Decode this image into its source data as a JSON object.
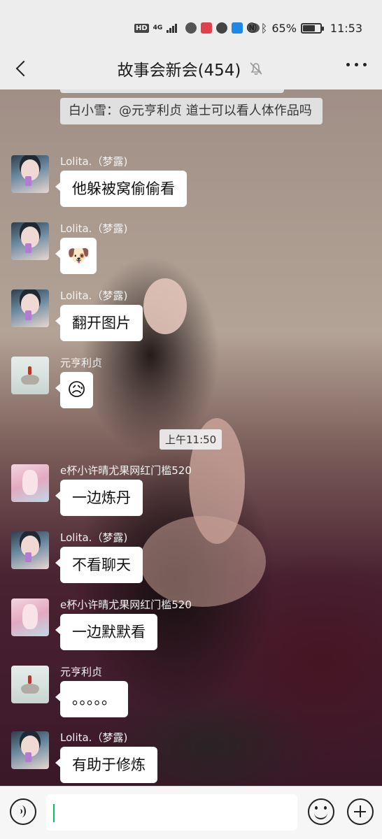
{
  "status_bar": {
    "hd": "HD",
    "network": "4G",
    "battery": "65%",
    "time": "11:53",
    "icons": [
      "hd-icon",
      "signal-icon",
      "app-icon",
      "app-icon",
      "app-icon",
      "app-icon",
      "wechat-icon",
      "nfc-icon",
      "bluetooth-icon",
      "battery-icon"
    ]
  },
  "header": {
    "title": "故事会新会(454)",
    "muted": true
  },
  "quoted_message": {
    "text": "白小雪：@元亨利贞 道士可以看人体作品吗"
  },
  "messages": [
    {
      "sender": "Lolita.（梦露)",
      "text": "他躲被窝偷偷看",
      "avatar": "lolita"
    },
    {
      "sender": "Lolita.（梦露)",
      "text": "🐶",
      "avatar": "lolita",
      "emoji": true
    },
    {
      "sender": "Lolita.（梦露)",
      "text": "翻开图片",
      "avatar": "lolita"
    },
    {
      "sender": "元亨利贞",
      "text": "😥",
      "avatar": "yuan",
      "emoji": true
    },
    {
      "sender": "e杯小许晴尤果网红门槛520",
      "text": "一边炼丹",
      "avatar": "xu"
    },
    {
      "sender": "Lolita.（梦露)",
      "text": "不看聊天",
      "avatar": "lolita"
    },
    {
      "sender": "e杯小许晴尤果网红门槛520",
      "text": "一边默默看",
      "avatar": "xu"
    },
    {
      "sender": "元亨利贞",
      "text": "。。。。。",
      "avatar": "yuan"
    },
    {
      "sender": "Lolita.（梦露)",
      "text": "有助于修炼",
      "avatar": "lolita"
    }
  ],
  "time_divider": "上午11:50",
  "colors": {
    "bar_bg": "#ededed",
    "bubble_bg": "#ffffff",
    "caret": "#07c160"
  }
}
